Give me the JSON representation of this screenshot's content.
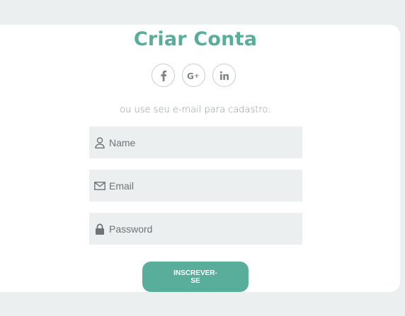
{
  "form": {
    "title": "Criar Conta",
    "social": [
      {
        "icon": "facebook-icon",
        "label": "f"
      },
      {
        "icon": "google-plus-icon",
        "label": "G+"
      },
      {
        "icon": "linkedin-icon",
        "label": "in"
      }
    ],
    "subtitle": "ou use seu e-mail para cadastro:",
    "name_placeholder": "Name",
    "email_placeholder": "Email",
    "password_placeholder": "Password",
    "submit_label": "INSCREVER-SE"
  },
  "colors": {
    "accent": "#58ae9b",
    "background": "#ecefef",
    "card": "#ffffff",
    "input_bg": "#ecefef"
  }
}
